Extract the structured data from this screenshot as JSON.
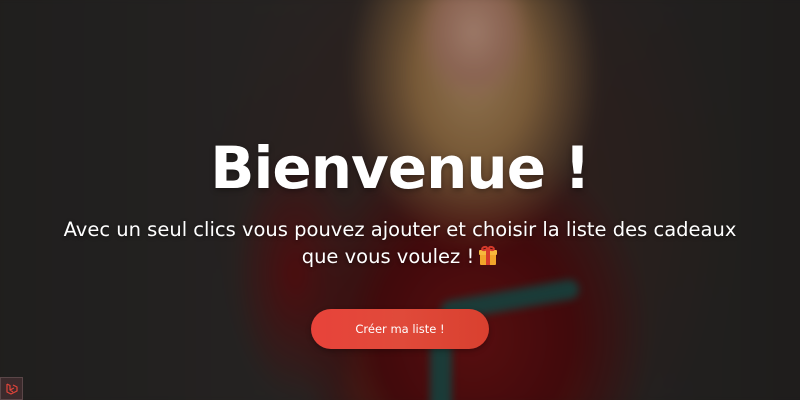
{
  "hero": {
    "title": "Bienvenue !",
    "subtitle_line1": "Avec un seul clics vous pouvez ajouter et choisir la liste des cadeaux",
    "subtitle_line2": "que vous voulez !",
    "subtitle_icon": "gift-icon",
    "cta_label": "Créer ma liste !"
  },
  "corner_widget": {
    "icon": "laravel-logo-icon"
  },
  "colors": {
    "cta": "#e8433a",
    "text": "#ffffff",
    "overlay": "#000000"
  }
}
